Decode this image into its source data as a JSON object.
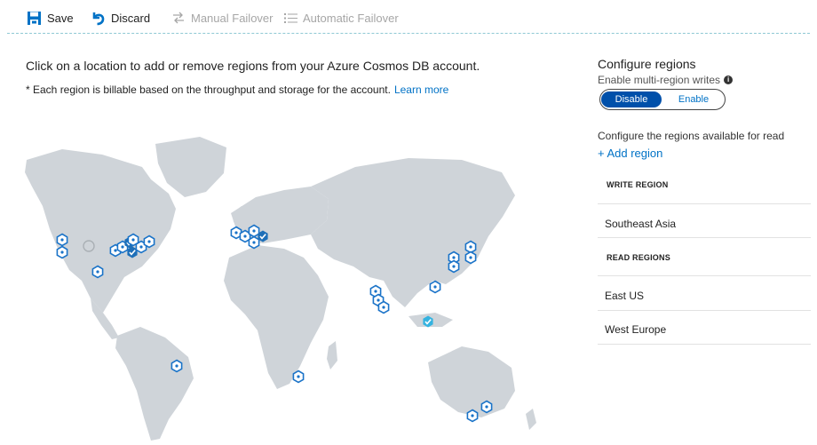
{
  "toolbar": {
    "save_label": "Save",
    "discard_label": "Discard",
    "manual_failover_label": "Manual Failover",
    "automatic_failover_label": "Automatic Failover",
    "accent": "#0072c6",
    "disabled_color": "#a6a6a6"
  },
  "main": {
    "instruction": "Click on a location to add or remove regions from your Azure Cosmos DB account.",
    "billing_note": "* Each region is billable based on the throughput and storage for the account.",
    "learn_more": "Learn more"
  },
  "map": {
    "marker_icon": "hexagon-plus-icon",
    "selected_marker_icon": "hexagon-check-icon",
    "land_color": "#cfd4d9",
    "marker_color": "#1a73c8",
    "selected_color": "#1e6fb8",
    "write_region_color": "#35b3e0"
  },
  "panel": {
    "title": "Configure regions",
    "multi_region_label": "Enable multi-region writes",
    "toggle": {
      "disable": "Disable",
      "enable": "Enable",
      "selected": "Disable"
    },
    "available_text": "Configure the regions available for read",
    "add_region": "+ Add region",
    "write_region_header": "WRITE REGION",
    "write_regions": [
      "Southeast Asia"
    ],
    "read_regions_header": "READ REGIONS",
    "read_regions": [
      "East US",
      "West Europe"
    ]
  }
}
